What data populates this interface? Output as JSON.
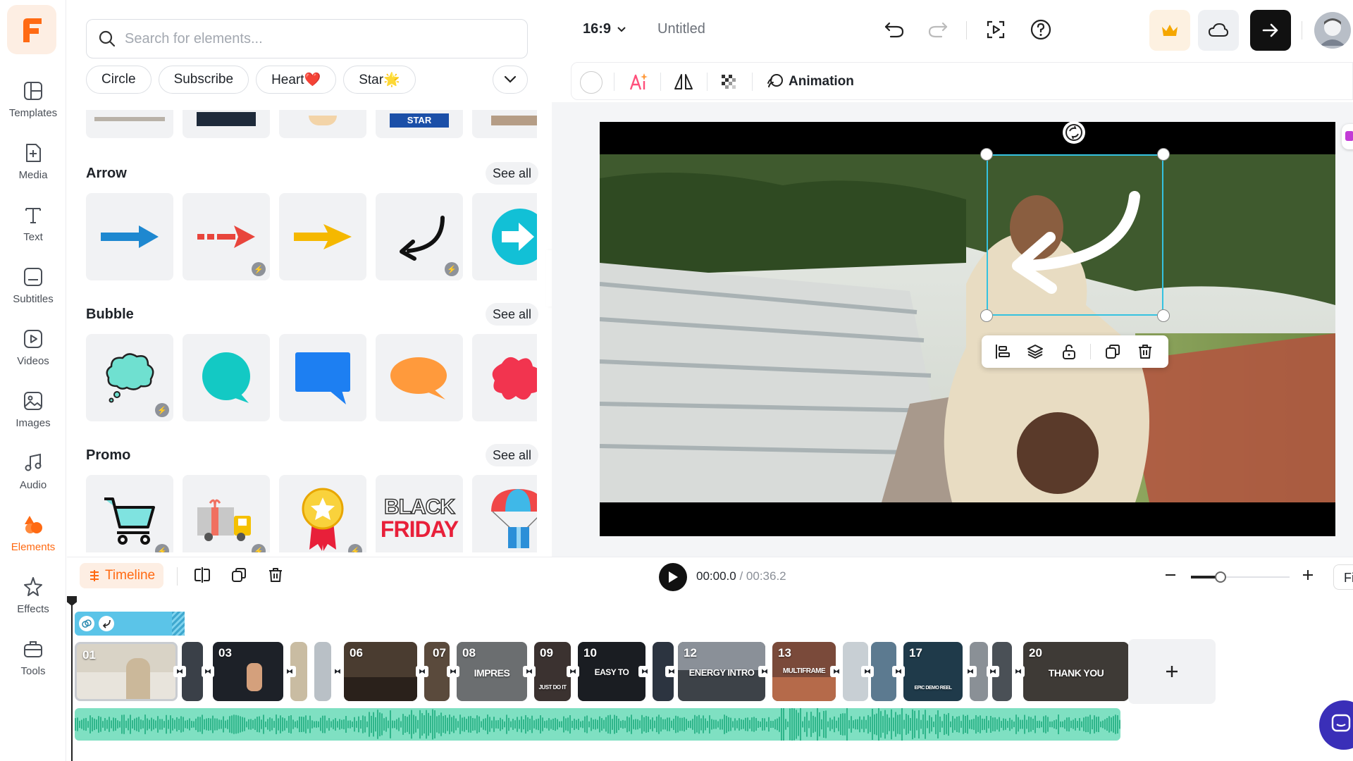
{
  "brand": {
    "logo_letter": "F",
    "accent": "#ff6a13"
  },
  "rail": {
    "items": [
      {
        "label": "Templates",
        "icon": "templates-icon"
      },
      {
        "label": "Media",
        "icon": "media-icon"
      },
      {
        "label": "Text",
        "icon": "text-icon"
      },
      {
        "label": "Subtitles",
        "icon": "subtitles-icon"
      },
      {
        "label": "Videos",
        "icon": "videos-icon"
      },
      {
        "label": "Images",
        "icon": "images-icon"
      },
      {
        "label": "Audio",
        "icon": "audio-icon"
      },
      {
        "label": "Elements",
        "icon": "elements-icon",
        "active": true
      },
      {
        "label": "Effects",
        "icon": "effects-icon"
      },
      {
        "label": "Tools",
        "icon": "tools-icon"
      }
    ]
  },
  "panel": {
    "search_placeholder": "Search for elements...",
    "chips": [
      "Circle",
      "Subscribe",
      "Heart❤️",
      "Star🌟"
    ],
    "top_row_partial_text": "STAR",
    "sections": [
      {
        "title": "Arrow",
        "see_all": "See all"
      },
      {
        "title": "Bubble",
        "see_all": "See all"
      },
      {
        "title": "Promo",
        "see_all": "See all"
      }
    ],
    "promo_tile_text": {
      "line1": "BLACK",
      "line2": "FRIDAY"
    }
  },
  "topbar": {
    "aspect_ratio": "16:9",
    "doc_title": "Untitled"
  },
  "toolbar": {
    "animation_label": "Animation"
  },
  "timeline": {
    "label": "Timeline",
    "current_time": "00:00.0",
    "separator": " / ",
    "total_time": "00:36.2",
    "zoom_level": 0.3,
    "fit_label": "Fi",
    "clips": [
      {
        "num": "01",
        "caption": ""
      },
      {
        "num": "03",
        "caption": ""
      },
      {
        "num": "06",
        "caption": ""
      },
      {
        "num": "07",
        "caption": ""
      },
      {
        "num": "08",
        "caption": "IMPRES"
      },
      {
        "num": "09",
        "caption": "JUST DO IT"
      },
      {
        "num": "10",
        "caption": "EASY TO"
      },
      {
        "num": "12",
        "caption": "ENERGY INTRO"
      },
      {
        "num": "13",
        "caption": "MULTIFRAME"
      },
      {
        "num": "17",
        "caption": "EPIC DEMO REEL"
      },
      {
        "num": "20",
        "caption": "THANK YOU"
      }
    ]
  }
}
